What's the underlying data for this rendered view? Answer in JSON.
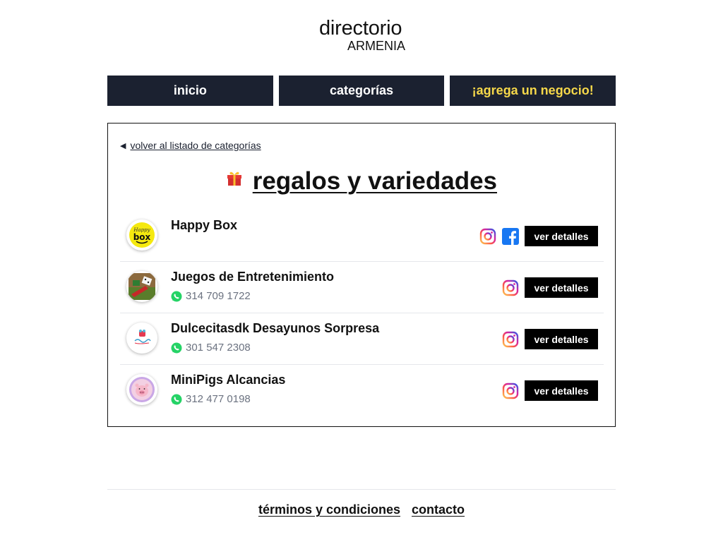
{
  "logo": {
    "main": "directorio",
    "sub": "ARMENIA"
  },
  "nav": [
    {
      "label": "inicio"
    },
    {
      "label": "categorías"
    },
    {
      "label": "¡agrega un negocio!"
    }
  ],
  "colors": {
    "nav_bg": "#1b2130",
    "nav_highlight": "#f6d84a",
    "button_bg": "#000000",
    "whatsapp": "#25d366"
  },
  "back": {
    "label": "volver al listado de categorías"
  },
  "category": {
    "icon": "gift-icon",
    "title": "regalos y variedades"
  },
  "businesses": [
    {
      "name": "Happy Box",
      "phone": "",
      "social": [
        "instagram-icon",
        "facebook-icon"
      ],
      "button": "ver detalles"
    },
    {
      "name": "Juegos de Entretenimiento",
      "phone": "314 709 1722",
      "social": [
        "instagram-icon"
      ],
      "button": "ver detalles"
    },
    {
      "name": "Dulcecitasdk Desayunos Sorpresa",
      "phone": "301 547 2308",
      "social": [
        "instagram-icon"
      ],
      "button": "ver detalles"
    },
    {
      "name": "MiniPigs Alcancias",
      "phone": "312 477 0198",
      "social": [
        "instagram-icon"
      ],
      "button": "ver detalles"
    }
  ],
  "footer": {
    "terms": "términos y condiciones",
    "contact": "contacto"
  }
}
